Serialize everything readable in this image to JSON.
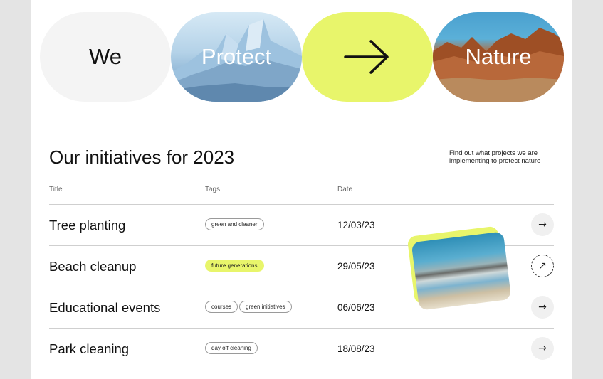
{
  "hero": {
    "we": "We",
    "protect": "Protect",
    "nature": "Nature",
    "arrow_icon": "arrow-right-icon",
    "accent_color": "#e8f56b"
  },
  "section": {
    "heading": "Our initiatives for 2023",
    "note": "Find out what projects we are implementing to protect nature"
  },
  "table": {
    "columns": {
      "title": "Title",
      "tags": "Tags",
      "date": "Date"
    },
    "rows": [
      {
        "title": "Tree planting",
        "tags": [
          "green and cleaner"
        ],
        "date": "12/03/23",
        "action_icon": "arrow-right-icon"
      },
      {
        "title": "Beach cleanup",
        "tags": [
          "future generations"
        ],
        "date": "29/05/23",
        "action_icon": "arrow-up-right-icon"
      },
      {
        "title": "Educational events",
        "tags": [
          "courses",
          "green initiatives"
        ],
        "date": "06/06/23",
        "action_icon": "arrow-right-icon"
      },
      {
        "title": "Park cleaning",
        "tags": [
          "day off cleaning"
        ],
        "date": "18/08/23",
        "action_icon": "arrow-right-icon"
      }
    ]
  }
}
